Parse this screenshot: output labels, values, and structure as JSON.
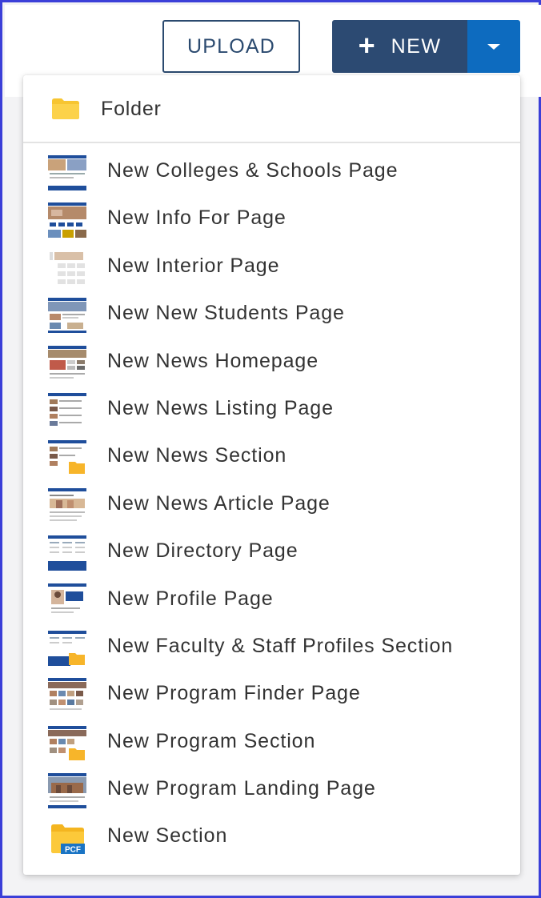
{
  "toolbar": {
    "upload_label": "UPLOAD",
    "new_label": "NEW",
    "new_icon": "plus-icon",
    "dropdown_icon": "caret-down-icon"
  },
  "colors": {
    "frame_border": "#3b3fd8",
    "upload_text": "#2b4a6f",
    "new_button": "#2c4a72",
    "dropdown_button": "#0d6bbf",
    "folder_yellow": "#f7c531",
    "thumb_blue": "#1f4e9b"
  },
  "menu": {
    "folder_label": "Folder",
    "folder_icon": "folder-icon",
    "items": [
      {
        "label": "New Colleges & Schools Page",
        "icon": "page-template-thumbnail"
      },
      {
        "label": "New Info For Page",
        "icon": "page-template-thumbnail"
      },
      {
        "label": "New Interior Page",
        "icon": "page-template-thumbnail"
      },
      {
        "label": "New New Students Page",
        "icon": "page-template-thumbnail"
      },
      {
        "label": "New News Homepage",
        "icon": "page-template-thumbnail"
      },
      {
        "label": "New News Listing Page",
        "icon": "page-template-thumbnail"
      },
      {
        "label": "New News Section",
        "icon": "section-template-thumbnail"
      },
      {
        "label": "New News Article Page",
        "icon": "page-template-thumbnail"
      },
      {
        "label": "New Directory Page",
        "icon": "page-template-thumbnail"
      },
      {
        "label": "New Profile Page",
        "icon": "page-template-thumbnail"
      },
      {
        "label": "New Faculty & Staff Profiles Section",
        "icon": "section-template-thumbnail"
      },
      {
        "label": "New Program Finder Page",
        "icon": "page-template-thumbnail"
      },
      {
        "label": "New Program Section",
        "icon": "section-template-thumbnail"
      },
      {
        "label": "New Program Landing Page",
        "icon": "page-template-thumbnail"
      },
      {
        "label": "New Section",
        "icon": "pcf-folder-icon",
        "badge": "PCF"
      }
    ]
  }
}
